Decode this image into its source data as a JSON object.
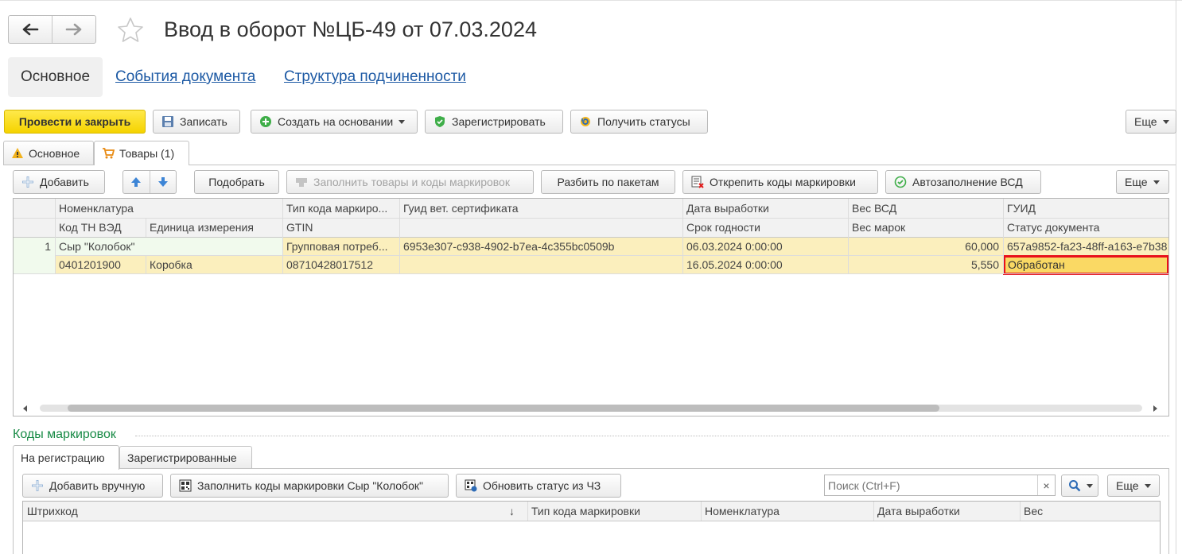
{
  "window": {
    "title": "Ввод в оборот №ЦБ-49 от 07.03.2024"
  },
  "nav": {
    "back_icon": "arrow-left-icon",
    "forward_icon": "arrow-right-icon",
    "favorite_icon": "star-icon"
  },
  "sections": {
    "active": "Основное",
    "links": [
      "События документа",
      "Структура подчиненности"
    ]
  },
  "toolbar": {
    "post_close": "Провести и закрыть",
    "save": "Записать",
    "create_based": "Создать на основании",
    "register": "Зарегистрировать",
    "get_statuses": "Получить статусы",
    "more": "Еще"
  },
  "doc_tabs": {
    "main": "Основное",
    "goods": "Товары (1)"
  },
  "goods_toolbar": {
    "add": "Добавить",
    "pick": "Подобрать",
    "fill_codes": "Заполнить товары и коды маркировок",
    "split_packages": "Разбить по пакетам",
    "detach_codes": "Открепить коды маркировки",
    "autofill_vsd": "Автозаполнение ВСД",
    "more": "Еще"
  },
  "goods_table": {
    "header_row1": [
      "Номенклатура",
      "Тип кода маркиро...",
      "Гуид вет. сертификата",
      "Дата выработки",
      "Вес ВСД",
      "ГУИД"
    ],
    "header_row2": [
      "Код ТН ВЭД",
      "Единица измерения",
      "GTIN",
      "Срок годности",
      "Вес марок",
      "Статус документа"
    ],
    "rows": [
      {
        "n": "1",
        "nomenclature": "Сыр \"Колобок\"",
        "code_type": "Групповая потреб...",
        "vet_guid": "6953e307-c938-4902-b7ea-4c355bc0509b",
        "prod_date": "06.03.2024 0:00:00",
        "vsd_weight": "60,000",
        "guid": "657a9852-fa23-48ff-a163-e7b38",
        "tnved": "0401201900",
        "unit": "Коробка",
        "gtin": "08710428017512",
        "expiry": "16.05.2024 0:00:00",
        "marks_weight": "5,550",
        "doc_status": "Обработан"
      }
    ]
  },
  "marking": {
    "title": "Коды маркировок",
    "tabs": [
      "На регистрацию",
      "Зарегистрированные"
    ],
    "add_manual": "Добавить вручную",
    "fill_codes": "Заполнить коды маркировки Сыр \"Колобок\"",
    "update_status": "Обновить статус из ЧЗ",
    "search_placeholder": "Поиск (Ctrl+F)",
    "search_clear": "×",
    "more": "Еще",
    "columns": [
      "Штрихкод",
      "↓",
      "Тип кода маркировки",
      "Номенклатура",
      "Дата выработки",
      "Вес"
    ]
  },
  "colors": {
    "primary_button": "#f5d300",
    "link": "#1c59a4",
    "section_title": "#178a45",
    "selected_row": "#fbefbd",
    "highlight_border": "#e8101b"
  }
}
